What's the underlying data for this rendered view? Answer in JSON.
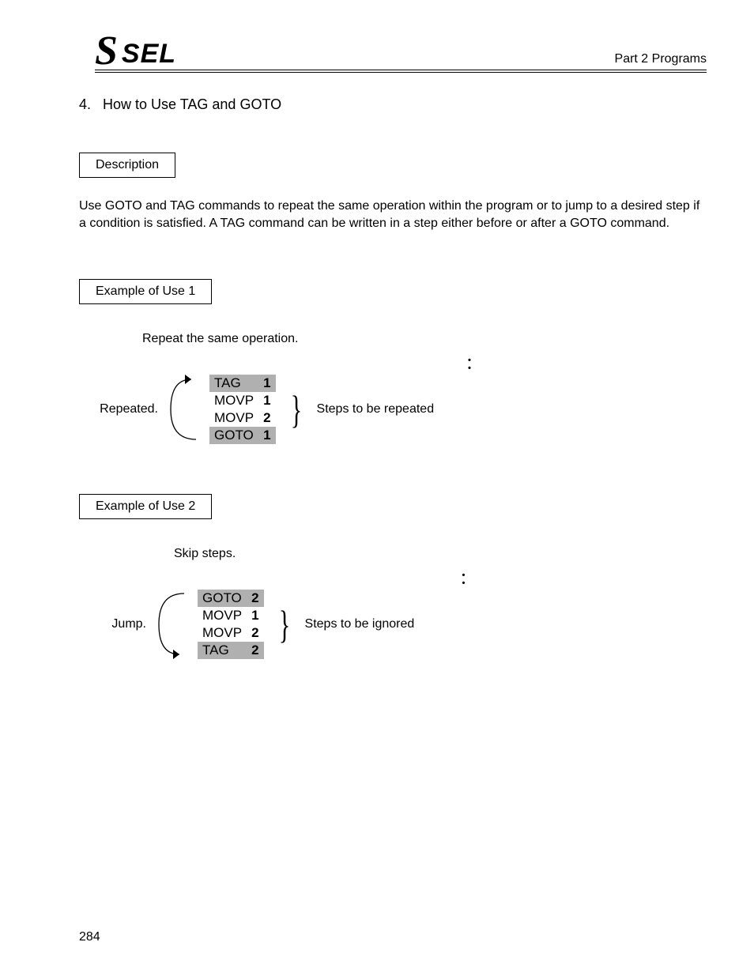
{
  "header": {
    "logo_s": "S",
    "logo_sel": "SEL",
    "part": "Part 2 Programs"
  },
  "section": {
    "number": "4.",
    "title": "How to Use TAG and GOTO"
  },
  "description": {
    "label": "Description",
    "body": "Use GOTO and TAG commands to repeat the same operation within the program or to jump to a desired step if a condition is satisfied. A TAG command can be written in a step either before or after a GOTO command."
  },
  "example1": {
    "label": "Example of Use 1",
    "caption": "Repeat the same operation.",
    "side": "Repeated.",
    "right": "Steps to be repeated",
    "rows": [
      {
        "cmd": "TAG",
        "val": "1",
        "hl": true
      },
      {
        "cmd": "MOVP",
        "val": "1",
        "hl": false
      },
      {
        "cmd": "MOVP",
        "val": "2",
        "hl": false
      },
      {
        "cmd": "GOTO",
        "val": "1",
        "hl": true
      }
    ]
  },
  "example2": {
    "label": "Example of Use 2",
    "caption": "Skip steps.",
    "side": "Jump.",
    "right": "Steps to be ignored",
    "rows": [
      {
        "cmd": "GOTO",
        "val": "2",
        "hl": true
      },
      {
        "cmd": "MOVP",
        "val": "1",
        "hl": false
      },
      {
        "cmd": "MOVP",
        "val": "2",
        "hl": false
      },
      {
        "cmd": "TAG",
        "val": "2",
        "hl": true
      }
    ]
  },
  "page_number": "284"
}
